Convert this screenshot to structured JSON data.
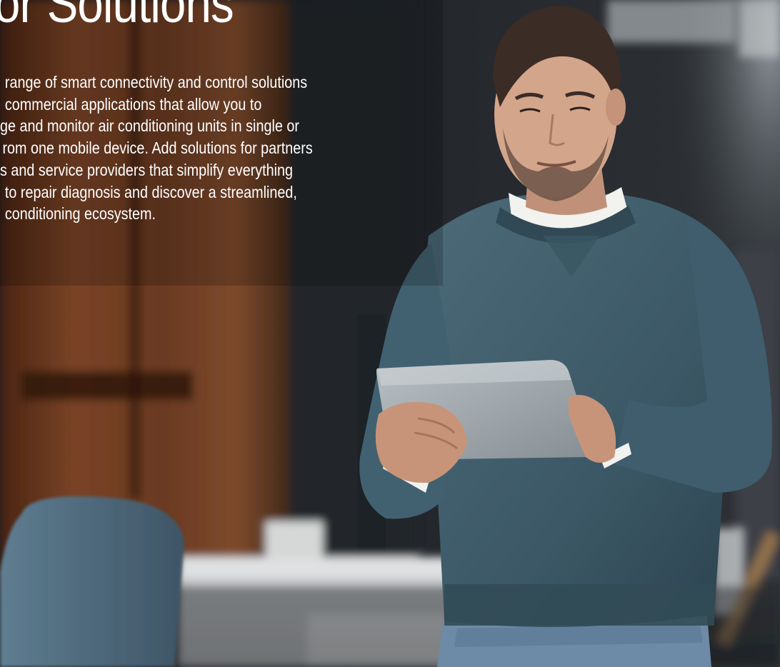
{
  "hero": {
    "title": "or Solutions",
    "body_lines": [
      "range of smart connectivity and control solutions",
      "commercial applications that allow you to",
      "ge and monitor air conditioning units in single or",
      "rom one mobile device. Add solutions for partners",
      "s and service providers that simplify everything",
      "to repair diagnosis and discover a streamlined,",
      "conditioning ecosystem."
    ],
    "body_indents": [
      8,
      8,
      0,
      4,
      0,
      8,
      8
    ]
  },
  "colors": {
    "text": "#ffffff",
    "wood_panel": "#6b3a21",
    "sweater": "#3f5b69",
    "tablet": "#9aa3a8",
    "background_dark": "#1b1e22"
  }
}
